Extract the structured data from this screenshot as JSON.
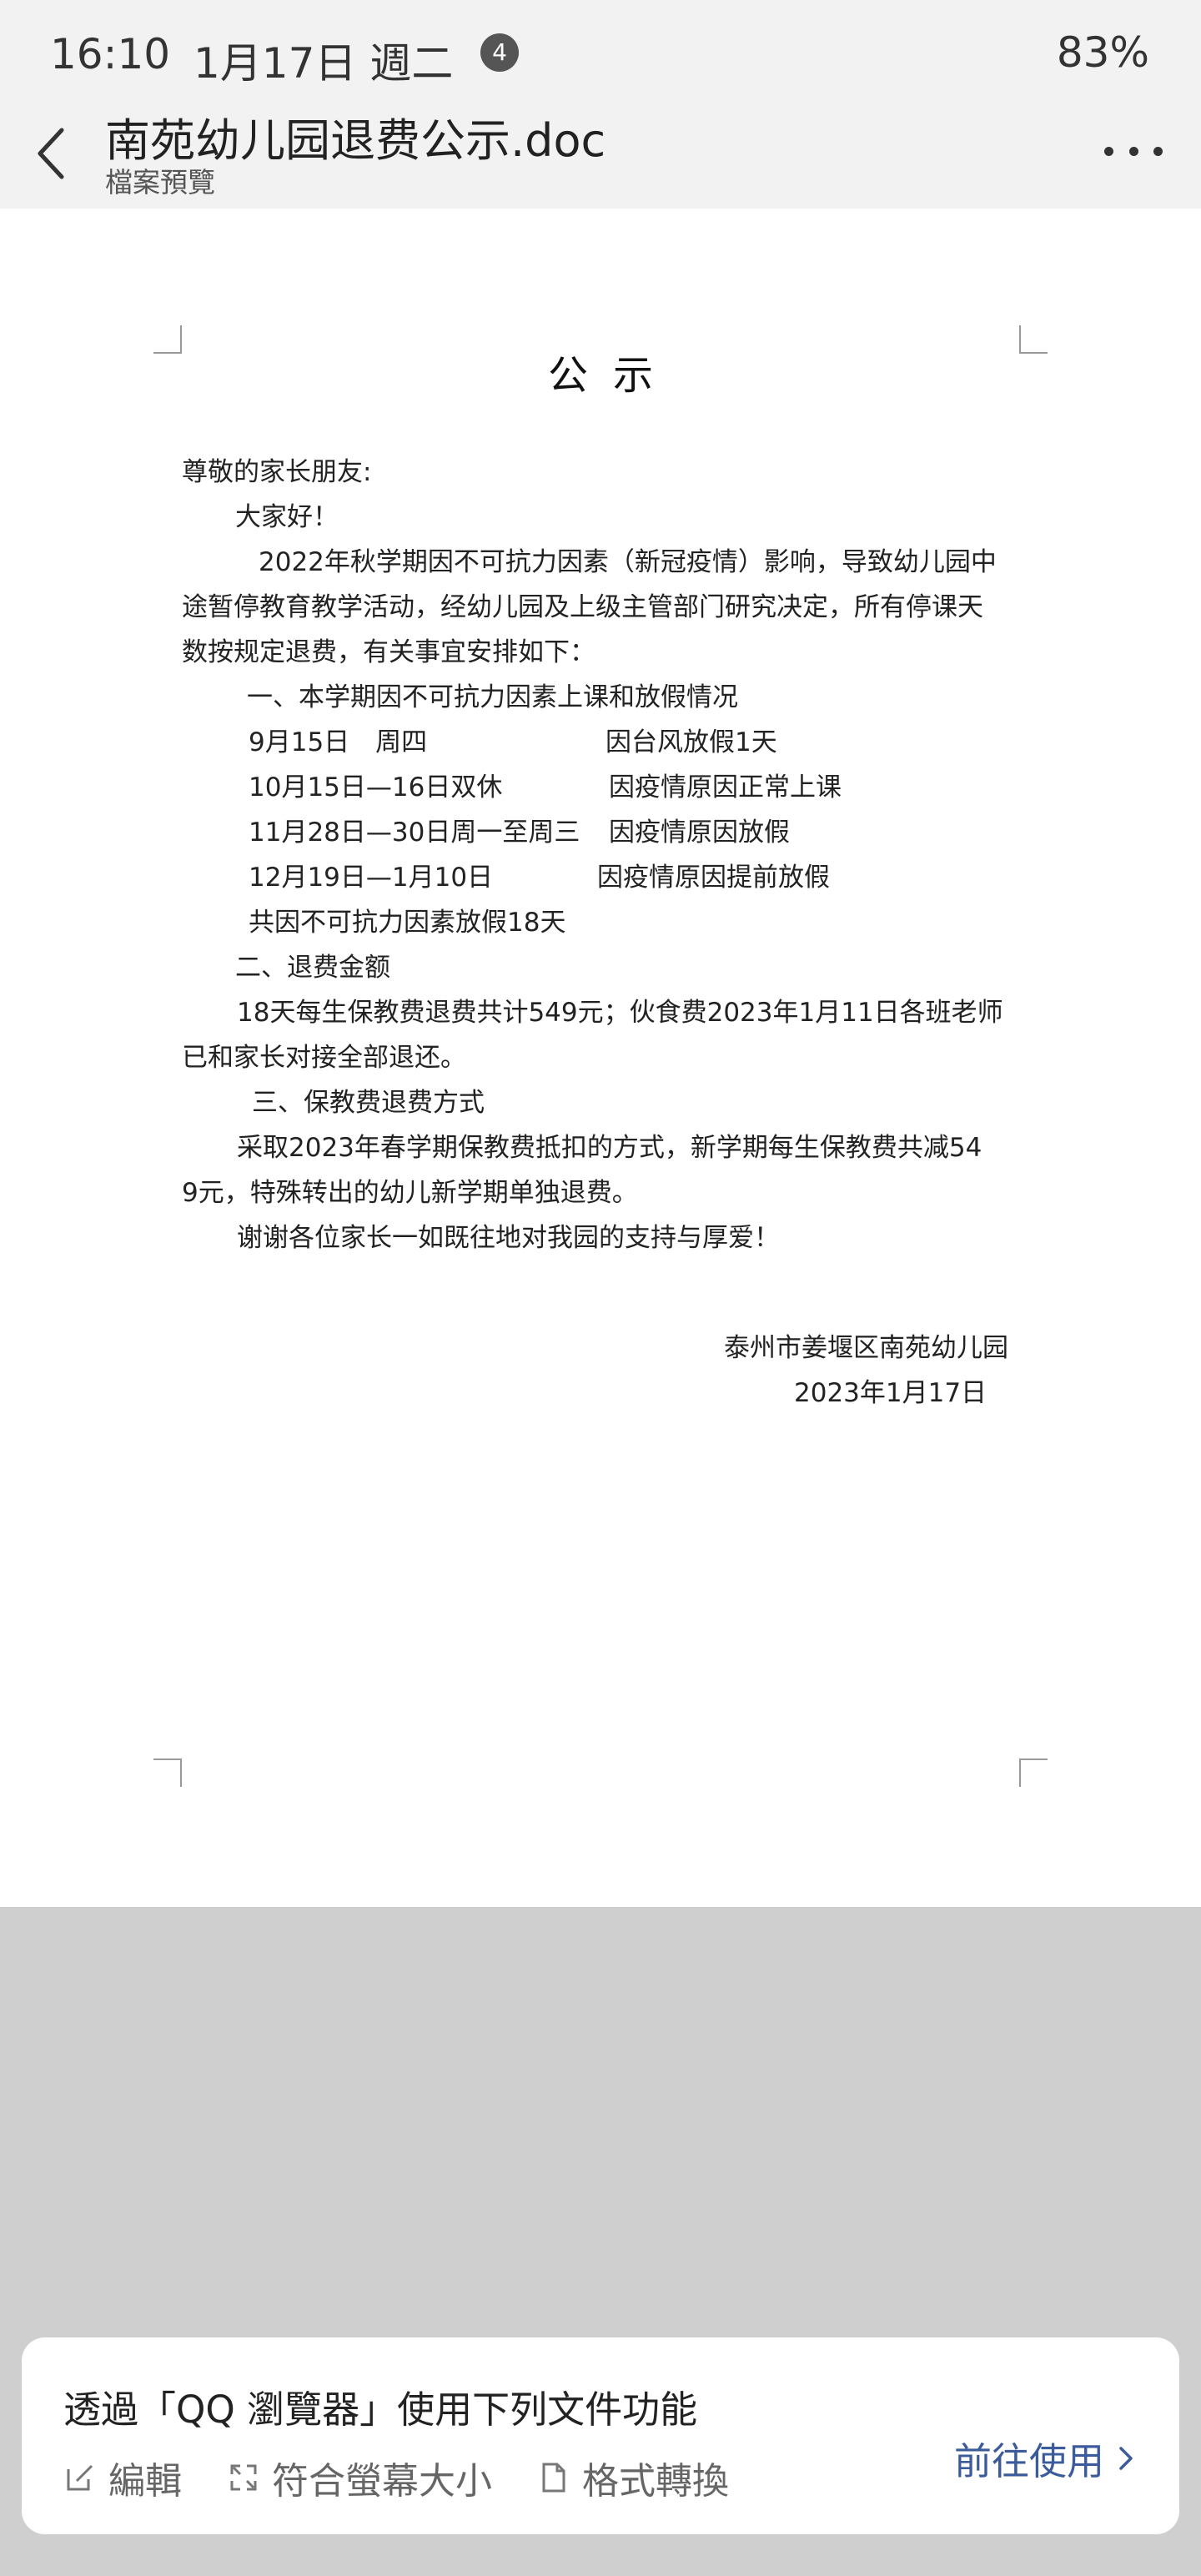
{
  "status_bar": {
    "time": "16:10",
    "date": "1月17日 週二",
    "notification_count": "4",
    "battery": "83%"
  },
  "header": {
    "title": "南苑幼儿园退费公示.doc",
    "subtitle": "檔案預覽"
  },
  "document": {
    "title": "公示",
    "salutation": "尊敬的家长朋友:",
    "greeting": "大家好！",
    "intro": [
      "2022年秋学期因不可抗力因素（新冠疫情）影响，导致幼儿园中",
      "途暂停教育教学活动，经幼儿园及上级主管部门研究决定，所有停课天",
      "数按规定退费，有关事宜安排如下："
    ],
    "section1": {
      "heading": "一、本学期因不可抗力因素上课和放假情况",
      "rows": [
        {
          "date": "9月15日　周四",
          "reason": "因台风放假1天"
        },
        {
          "date": "10月15日—16日双休",
          "reason": "因疫情原因正常上课"
        },
        {
          "date": "11月28日—30日周一至周三",
          "reason": "因疫情原因放假"
        },
        {
          "date": "12月19日—1月10日",
          "reason": "因疫情原因提前放假"
        }
      ],
      "total": "共因不可抗力因素放假18天"
    },
    "section2": {
      "heading": "二、退费金额",
      "lines": [
        "18天每生保教费退费共计549元；伙食费2023年1月11日各班老师",
        "已和家长对接全部退还。"
      ]
    },
    "section3": {
      "heading": "三、保教费退费方式",
      "lines": [
        "采取2023年春学期保教费抵扣的方式，新学期每生保教费共减54",
        "9元，特殊转出的幼儿新学期单独退费。"
      ]
    },
    "thanks": "谢谢各位家长一如既往地对我园的支持与厚爱！",
    "signature": "泰州市姜堰区南苑幼儿园",
    "date": "2023年1月17日"
  },
  "bottom_card": {
    "title": "透過「QQ 瀏覽器」使用下列文件功能",
    "options": [
      {
        "label": "編輯",
        "icon": "edit-icon"
      },
      {
        "label": "符合螢幕大小",
        "icon": "fit-screen-icon"
      },
      {
        "label": "格式轉換",
        "icon": "document-icon"
      }
    ],
    "action": "前往使用",
    "accent_color": "#3b5b9a"
  }
}
